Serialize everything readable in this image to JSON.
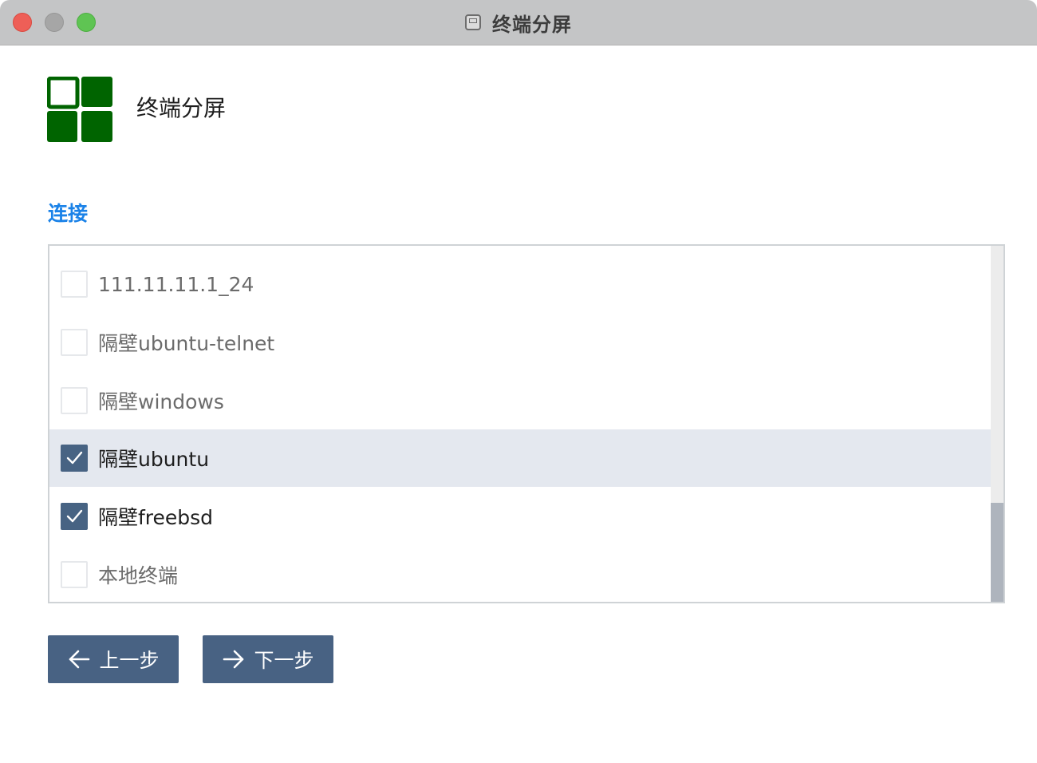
{
  "window": {
    "title": "终端分屏",
    "title_icon": "ssh-terminal-icon"
  },
  "header": {
    "app_icon": "grid-split-icon",
    "app_icon_color": "#006400",
    "title": "终端分屏"
  },
  "section": {
    "label": "连接",
    "label_color": "#1a82e8"
  },
  "connections": [
    {
      "label": "111.11.11.1_24",
      "checked": false,
      "selected": false
    },
    {
      "label": "隔壁ubuntu-telnet",
      "checked": false,
      "selected": false
    },
    {
      "label": "隔壁windows",
      "checked": false,
      "selected": false
    },
    {
      "label": "隔壁ubuntu",
      "checked": true,
      "selected": true
    },
    {
      "label": "隔壁freebsd",
      "checked": true,
      "selected": false
    },
    {
      "label": "本地终端",
      "checked": false,
      "selected": false
    }
  ],
  "buttons": {
    "prev_label": "上一步",
    "prev_icon": "arrow-left-icon",
    "next_label": "下一步",
    "next_icon": "arrow-right-icon",
    "color": "#486283"
  }
}
